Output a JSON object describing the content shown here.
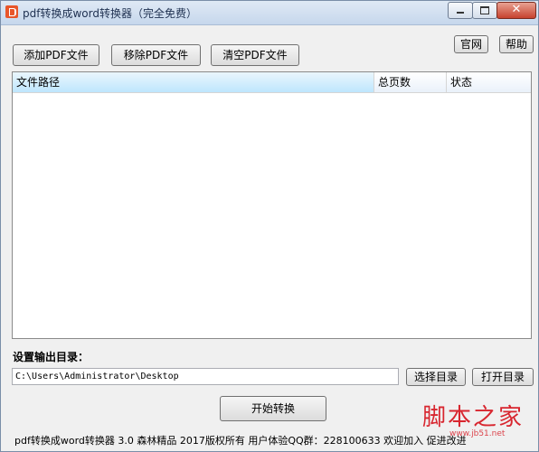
{
  "window": {
    "title": "pdf转换成word转换器（完全免费）",
    "close_symbol": "✕"
  },
  "toolbar": {
    "add_pdf": "添加PDF文件",
    "remove_pdf": "移除PDF文件",
    "clear_pdf": "清空PDF文件",
    "official_site": "官网",
    "help": "帮助"
  },
  "file_list": {
    "columns": [
      "文件路径",
      "总页数",
      "状态"
    ],
    "rows": []
  },
  "output": {
    "label": "设置输出目录：",
    "path": "C:\\Users\\Administrator\\Desktop",
    "choose_dir": "选择目录",
    "open_dir": "打开目录"
  },
  "actions": {
    "start": "开始转换"
  },
  "footer": {
    "text": "pdf转换成word转换器 3.0 森林精品 2017版权所有 用户体验QQ群：228100633 欢迎加入 促进改进"
  },
  "watermark": {
    "brand": "脚本之家",
    "url": "www.jb51.net"
  },
  "colors": {
    "selected_header": "#bee6fd",
    "watermark": "#d8262f",
    "title_bar": "#c6d7ec"
  }
}
